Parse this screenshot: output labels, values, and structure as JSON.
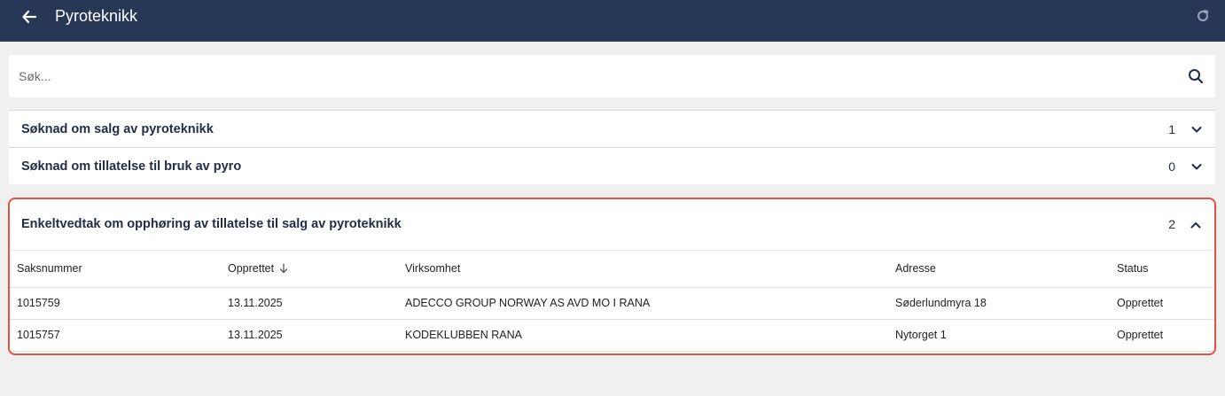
{
  "header": {
    "title": "Pyroteknikk",
    "background": "#263856",
    "back_icon": "arrow-left-icon",
    "refresh_icon": "refresh-icon"
  },
  "search": {
    "placeholder": "Søk...",
    "value": "",
    "icon": "search-icon"
  },
  "groups": [
    {
      "title": "Søknad om salg av pyroteknikk",
      "count": "1",
      "expanded": false
    },
    {
      "title": "Søknad om tillatelse til bruk av pyro",
      "count": "0",
      "expanded": false
    }
  ],
  "expanded_group": {
    "title": "Enkeltvedtak om opphøring av tillatelse til salg av pyroteknikk",
    "count": "2",
    "expanded": true,
    "highlight_color": "#e5533c",
    "columns": [
      "Saksnummer",
      "Opprettet",
      "Virksomhet",
      "Adresse",
      "Status"
    ],
    "sorted_column": "Opprettet",
    "sort_direction": "descending",
    "rows": [
      [
        "1015759",
        "13.11.2025",
        "ADECCO GROUP NORWAY AS AVD MO I RANA",
        "Søderlundmyra 18",
        "Opprettet"
      ],
      [
        "1015757",
        "13.11.2025",
        "KODEKLUBBEN RANA",
        "Nytorget 1",
        "Opprettet"
      ]
    ]
  }
}
